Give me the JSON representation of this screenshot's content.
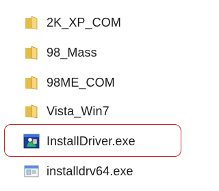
{
  "items": [
    {
      "label": "2K_XP_COM",
      "icon": "folder-icon"
    },
    {
      "label": "98_Mass",
      "icon": "folder-icon"
    },
    {
      "label": "98ME_COM",
      "icon": "folder-icon"
    },
    {
      "label": "Vista_Win7",
      "icon": "folder-icon"
    },
    {
      "label": "InstallDriver.exe",
      "icon": "installer-exe-icon"
    },
    {
      "label": "installdrv64.exe",
      "icon": "application-exe-icon"
    }
  ],
  "colors": {
    "highlight_border": "#c62828",
    "folder_yellow": "#e8bf48",
    "folder_dark": "#b88a1e",
    "text": "#1a1a1a"
  }
}
